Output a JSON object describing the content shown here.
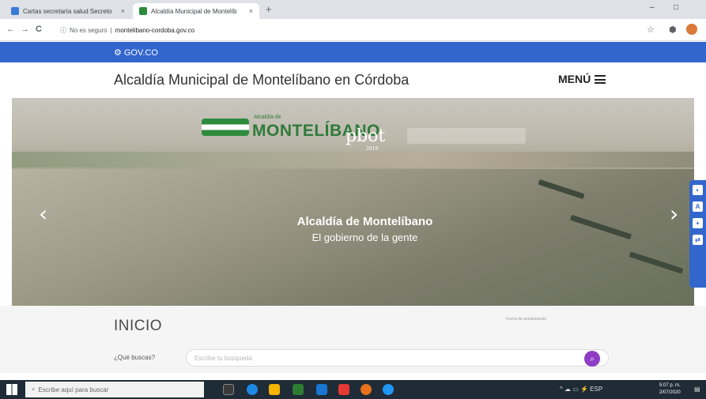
{
  "browser": {
    "tabs": [
      {
        "label": "Cartas secretaría salud Secreto",
        "close": "×"
      },
      {
        "label": "Alcaldía Municipal de Montelíb",
        "close": "×"
      }
    ],
    "new_tab": "+",
    "controls": {
      "minimize": "–",
      "restore": "□"
    },
    "nav": {
      "back": "←",
      "forward": "→",
      "reload": "C"
    },
    "address": {
      "security": "No es seguro",
      "url": "montelibano-cordoba.gov.co"
    },
    "right_icons": {
      "star": "☆",
      "ext": "⬢"
    }
  },
  "govbar": {
    "brand": "GOV.CO"
  },
  "header": {
    "title": "Alcaldía Municipal de Montelíbano en Córdoba",
    "menu_label": "MENÚ"
  },
  "hero": {
    "logo_small": "Alcaldía de",
    "logo_text": "MONTELÍBANO",
    "pbot_text": "pbot",
    "pbot_sub": "2019",
    "caption_title": "Alcaldía de Montelíbano",
    "caption_subtitle": "El gobierno de la gente",
    "prev": "‹",
    "next": "›",
    "slides": 5,
    "active_slide": 1
  },
  "accessibility": [
    "◐",
    "A",
    "+",
    "⇄"
  ],
  "lower": {
    "title": "INICIO",
    "last_update": "Fecha de actualización",
    "search_label": "¿Qué buscas?",
    "search_placeholder": "Escribe tu búsqueda",
    "search_icon": "⌕"
  },
  "taskbar": {
    "search_placeholder": "Escribe aquí para buscar",
    "tray": "^ ☁ ▭ ⚡ ESP",
    "time": "5:07 p. m.",
    "date": "2/07/2020"
  },
  "colors": {
    "gov_blue": "#3366cc",
    "search_purple": "#8e3cc4",
    "taskbar": "#1f2b36"
  }
}
